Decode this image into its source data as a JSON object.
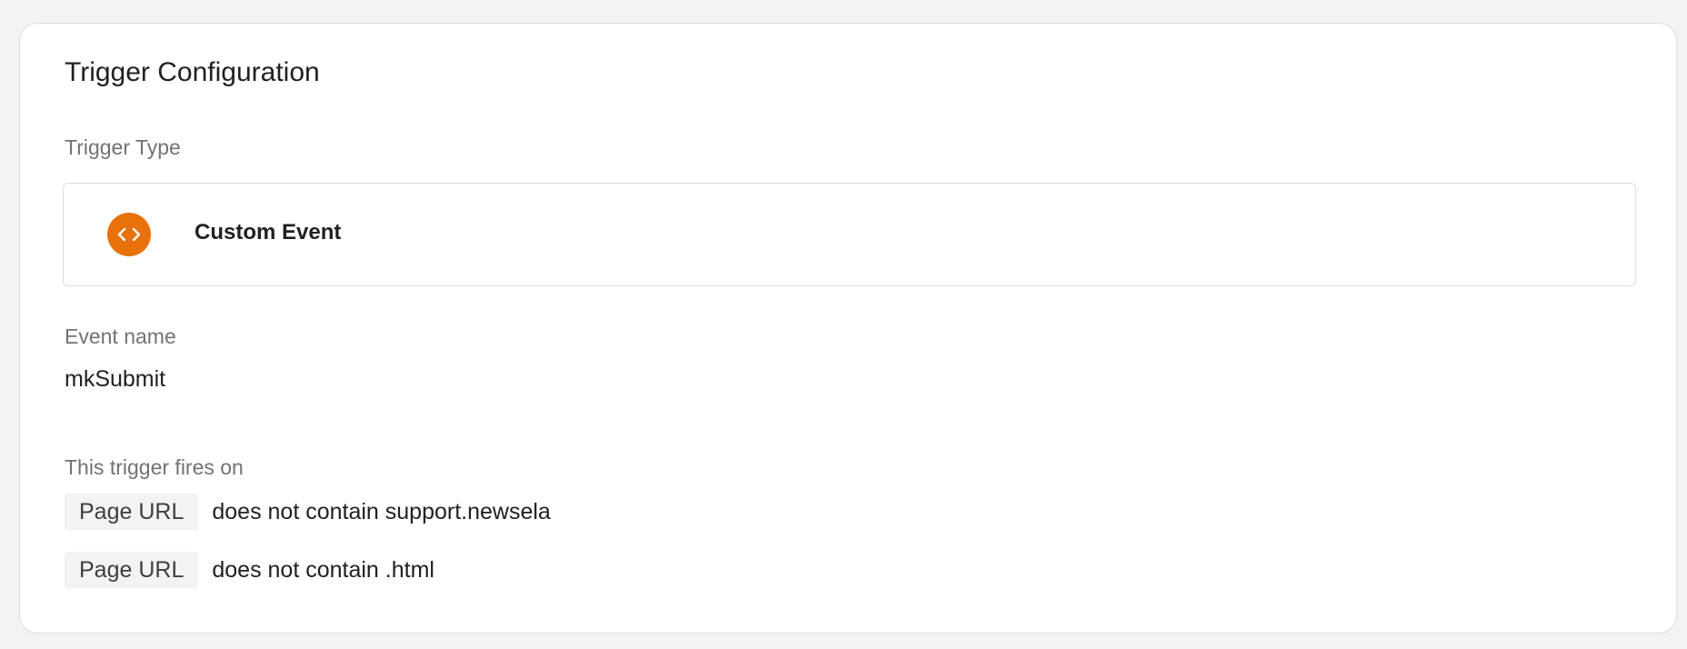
{
  "card": {
    "title": "Trigger Configuration"
  },
  "trigger_type": {
    "label": "Trigger Type",
    "name": "Custom Event",
    "icon": "code-brackets-icon",
    "icon_color": "#e8710a"
  },
  "event_name": {
    "label": "Event name",
    "value": "mkSubmit"
  },
  "fires_on": {
    "label": "This trigger fires on",
    "conditions": [
      {
        "variable": "Page URL",
        "operator_value": "does not contain support.newsela"
      },
      {
        "variable": "Page URL",
        "operator_value": "does not contain .html"
      }
    ]
  }
}
